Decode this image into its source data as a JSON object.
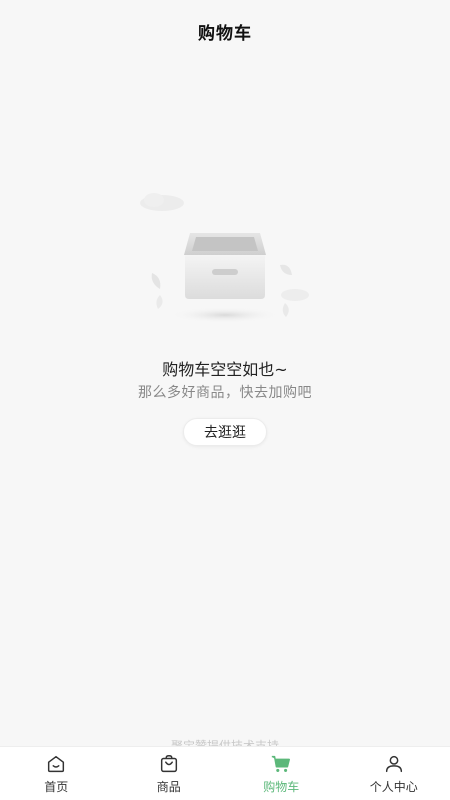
{
  "header": {
    "title": "购物车"
  },
  "empty_state": {
    "icon": "empty-box-illustration",
    "title": "购物车空空如也~",
    "subtitle": "那么多好商品，快去加购吧",
    "button_label": "去逛逛"
  },
  "footer": {
    "support_text": "聚宝赞提供技术支持"
  },
  "tabbar": {
    "items": [
      {
        "label": "首页",
        "icon": "home-icon"
      },
      {
        "label": "商品",
        "icon": "shopping-bag-icon"
      },
      {
        "label": "购物车",
        "icon": "cart-icon"
      },
      {
        "label": "个人中心",
        "icon": "user-icon"
      }
    ],
    "active_index": 2
  },
  "colors": {
    "accent": "#5cb87a",
    "background": "#f7f7f7",
    "tab_inactive": "#333333",
    "subtitle": "#888888"
  }
}
